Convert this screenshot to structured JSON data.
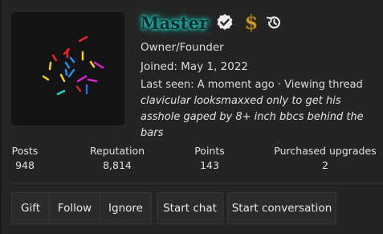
{
  "profile": {
    "username": "Master",
    "title": "Owner/Founder",
    "joined_label": "Joined:",
    "joined_date": "May 1, 2022",
    "last_seen_label": "Last seen:",
    "last_seen_value": "A moment ago · Viewing thread",
    "thread_title": "clavicular looksmaxxed only to get his asshole gaped by 8+ inch bbcs behind the bars"
  },
  "badges": {
    "verified_icon": "verified-check-icon",
    "dollar_icon": "dollar-sign-icon",
    "history_icon": "history-icon",
    "username_glow_color": "#1fd1c7",
    "dollar_color": "#c9a227"
  },
  "stats": [
    {
      "label": "Posts",
      "value": "948"
    },
    {
      "label": "Reputation",
      "value": "8,814"
    },
    {
      "label": "Points",
      "value": "143"
    },
    {
      "label": "Purchased upgrades",
      "value": "2"
    }
  ],
  "actions": {
    "gift": "Gift",
    "follow": "Follow",
    "ignore": "Ignore",
    "start_chat": "Start chat",
    "start_conversation": "Start conversation"
  }
}
